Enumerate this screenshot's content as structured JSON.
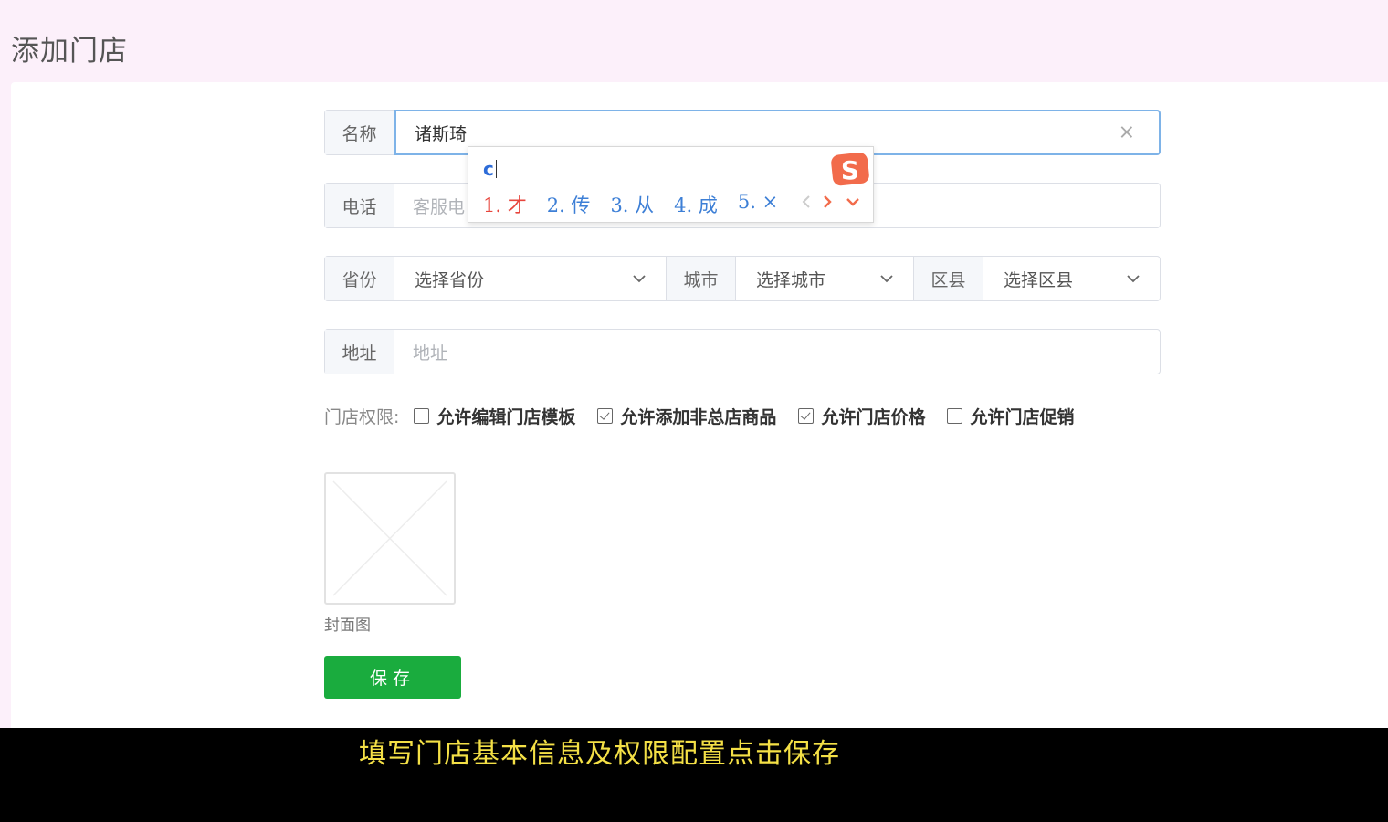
{
  "page": {
    "title": "添加门店"
  },
  "form": {
    "name": {
      "label": "名称",
      "value": "诸斯琦"
    },
    "phone": {
      "label": "电话",
      "placeholder": "客服电"
    },
    "province": {
      "label": "省份",
      "value": "选择省份"
    },
    "city": {
      "label": "城市",
      "value": "选择城市"
    },
    "district": {
      "label": "区县",
      "value": "选择区县"
    },
    "address": {
      "label": "地址",
      "placeholder": "地址"
    },
    "permissions": {
      "label": "门店权限:",
      "items": [
        {
          "label": "允许编辑门店模板",
          "checked": false
        },
        {
          "label": "允许添加非总店商品",
          "checked": true
        },
        {
          "label": "允许门店价格",
          "checked": true
        },
        {
          "label": "允许门店促销",
          "checked": false
        }
      ]
    },
    "cover": {
      "label": "封面图"
    },
    "save_label": "保存"
  },
  "ime": {
    "input": "c",
    "candidates": [
      "1. 才",
      "2. 传",
      "3. 从",
      "4. 成",
      "5. ×"
    ],
    "active_index": 0,
    "logo_letter": "S"
  },
  "subtitle": "填写门店基本信息及权限配置点击保存",
  "colors": {
    "primary": "#1aac3e",
    "focus": "#7eb3e8",
    "subtitle": "#f4e046",
    "ime_blue": "#3d7fd6",
    "ime_red": "#e7453c"
  }
}
